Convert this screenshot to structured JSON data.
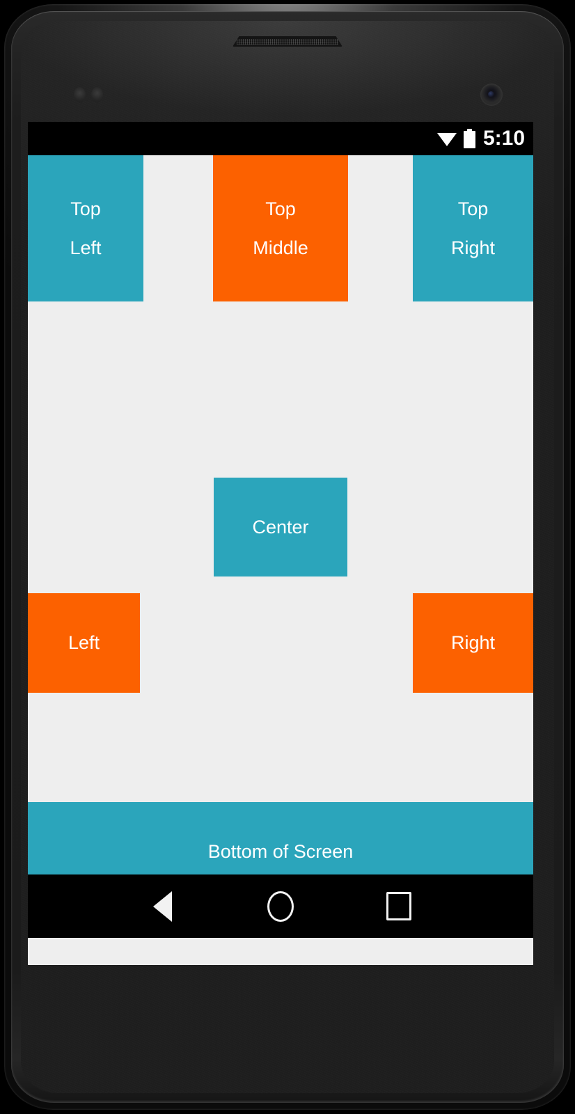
{
  "device": {
    "type": "android-phone-mockup",
    "screen_background": "#eeeeee"
  },
  "status_bar": {
    "background": "#000000",
    "time": "5:10",
    "icons": [
      "wifi-icon",
      "battery-icon"
    ]
  },
  "colors": {
    "teal": "#2ba5bb",
    "orange": "#fc6100",
    "screen_bg": "#eeeeee",
    "text": "#ffffff",
    "nav_bg": "#000000"
  },
  "content": {
    "boxes": [
      {
        "id": "top-left",
        "lines": [
          "Top",
          "Left"
        ],
        "color": "#2ba5bb",
        "position": "top-left"
      },
      {
        "id": "top-middle",
        "lines": [
          "Top",
          "Middle"
        ],
        "color": "#fc6100",
        "position": "top-center"
      },
      {
        "id": "top-right",
        "lines": [
          "Top",
          "Right"
        ],
        "color": "#2ba5bb",
        "position": "top-right"
      },
      {
        "id": "center",
        "lines": [
          "Center"
        ],
        "color": "#2ba5bb",
        "position": "center"
      },
      {
        "id": "left",
        "lines": [
          "Left"
        ],
        "color": "#fc6100",
        "position": "center-left"
      },
      {
        "id": "right",
        "lines": [
          "Right"
        ],
        "color": "#fc6100",
        "position": "center-right"
      },
      {
        "id": "bottom",
        "lines": [
          "Bottom of Screen"
        ],
        "color": "#2ba5bb",
        "position": "bottom-full-width"
      }
    ]
  },
  "nav_bar": {
    "background": "#000000",
    "buttons": [
      {
        "id": "back",
        "icon": "back-triangle-icon"
      },
      {
        "id": "home",
        "icon": "home-circle-icon"
      },
      {
        "id": "recent",
        "icon": "recents-square-icon"
      }
    ]
  }
}
